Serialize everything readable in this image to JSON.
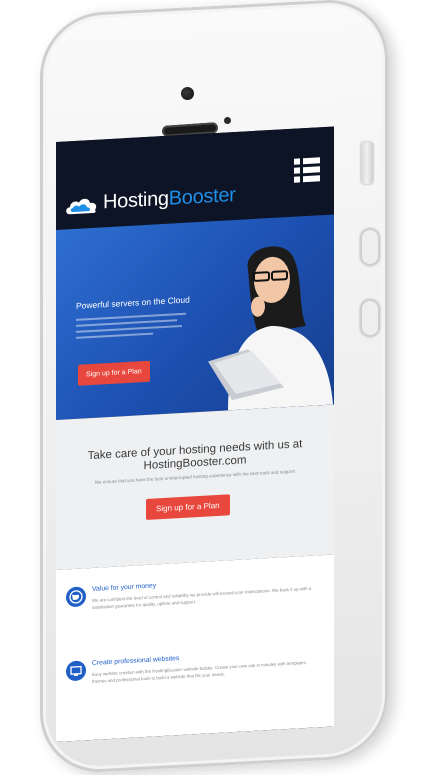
{
  "header": {
    "logo_part1": "Hosting",
    "logo_part2": "Booster",
    "menu_icon": "menu-icon"
  },
  "hero": {
    "title": "Powerful servers on the Cloud",
    "cta": "Sign up for a Plan"
  },
  "intro": {
    "title": "Take care of your hosting needs with us at HostingBooster.com",
    "subtitle": "We ensure that you have the best uninterrupted hosting experience with the best tools and support",
    "cta": "Sign up for a Plan"
  },
  "features": [
    {
      "icon": "globe-icon",
      "title": "Value for your money",
      "text": "We are confident the level of control and reliability we provide will exceed your expectations. We back it up with a satisfaction guarantee for quality, uptime and support."
    },
    {
      "icon": "monitor-icon",
      "title": "Create professional websites",
      "text": "Easy website creation with the HostingBooster website builder. Create your own site in minutes with templates, themes and professional tools to build a website that fits your needs."
    }
  ],
  "colors": {
    "nav": "#0c1426",
    "hero": "#2e6fd1",
    "accent_red": "#e7473c",
    "feature_blue": "#1f5fc6"
  }
}
